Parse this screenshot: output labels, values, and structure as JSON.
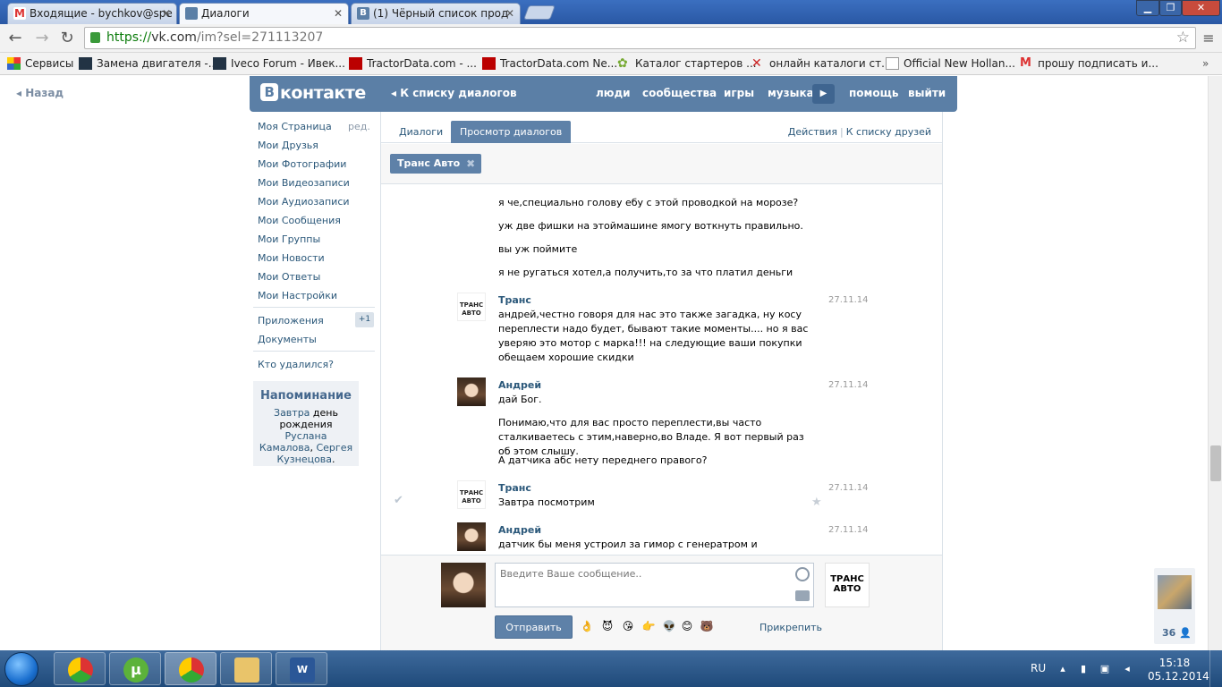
{
  "browser": {
    "tabs": [
      {
        "title": "Входящие - bychkov@spe",
        "icon": "gmail-icon"
      },
      {
        "title": "Диалоги",
        "icon": "vk-dialog-icon"
      },
      {
        "title": "(1) Чёрный список прод",
        "icon": "vk-icon"
      }
    ],
    "url_scheme": "https://",
    "url_host": "vk.com",
    "url_path": "/im?sel=271113207",
    "bookmarks": [
      {
        "label": "Сервисы",
        "icon": "apps-grid-icon"
      },
      {
        "label": "Замена двигателя -...",
        "icon": "iveco-icon"
      },
      {
        "label": "Iveco Forum - Ивек...",
        "icon": "iveco-icon"
      },
      {
        "label": "TractorData.com - ...",
        "icon": "td-icon"
      },
      {
        "label": "TractorData.com Ne...",
        "icon": "td-icon"
      },
      {
        "label": "Каталог стартеров ...",
        "icon": "gear-icon"
      },
      {
        "label": "онлайн каталоги ст...",
        "icon": "cross-icon"
      },
      {
        "label": "Official New Hollan...",
        "icon": "page-icon"
      },
      {
        "label": "прошу подписать и...",
        "icon": "gmail-icon"
      }
    ]
  },
  "vk": {
    "back_label": "Назад",
    "logo_text": "контакте",
    "logo_letter": "В",
    "header_back": "К списку диалогов",
    "nav": [
      "люди",
      "сообщества",
      "игры",
      "музыка",
      "помощь",
      "выйти"
    ],
    "menu": {
      "edit": "ред.",
      "items": [
        "Моя Страница",
        "Мои Друзья",
        "Мои Фотографии",
        "Мои Видеозаписи",
        "Мои Аудиозаписи",
        "Мои Сообщения",
        "Мои Группы",
        "Мои Новости",
        "Мои Ответы",
        "Мои Настройки"
      ],
      "apps": "Приложения",
      "apps_badge": "+1",
      "docs": "Документы",
      "who_deleted": "Кто удалился?"
    },
    "reminder": {
      "title": "Напоминание",
      "tomorrow": "Завтра",
      "text1": " день рождения ",
      "person1": "Руслана Камалова",
      "comma": ", ",
      "person2": "Сергея Кузнецова",
      "dot": "."
    },
    "tabs": [
      "Диалоги",
      "Просмотр диалогов"
    ],
    "actions": "Действия",
    "friends_list": "К списку друзей",
    "peer_chip": "Транс Авто",
    "messages": [
      {
        "author": "",
        "date": "",
        "lines": [
          "я че,специально голову ебу с этой проводкой на морозе?"
        ]
      },
      {
        "author": "",
        "date": "",
        "lines": [
          "уж две фишки на этоймашине ямогу воткнуть правильно."
        ]
      },
      {
        "author": "",
        "date": "",
        "lines": [
          "вы уж поймите"
        ]
      },
      {
        "author": "",
        "date": "",
        "lines": [
          "я не ругаться хотел,а получить,то за что платил деньги"
        ]
      },
      {
        "author": "Транс",
        "date": "27.11.14",
        "lines": [
          "андрей,честно говоря для нас это также загадка, ну косу переплести надо будет, бывают такие моменты.... но я вас уверяю это мотор с марка!!! на следующие ваши покупки обещаем хорошие скидки"
        ]
      },
      {
        "author": "Андрей",
        "date": "27.11.14",
        "lines": [
          "дай Бог.",
          "Понимаю,что для вас просто переплести,вы часто сталкиваетесь с этим,наверно,во Владе. Я вот первый раз об этом слышу.",
          "А датчика абс нету переднего правого?"
        ]
      },
      {
        "author": "Транс",
        "date": "27.11.14",
        "lines": [
          "Завтра посмотрим"
        ]
      },
      {
        "author": "Андрей",
        "date": "27.11.14",
        "lines": [
          "датчик бы меня устроил за гимор с генератром и проводкой"
        ]
      }
    ],
    "trans_avatar_text": "ТРАНС АВТО",
    "input_placeholder": "Введите Ваше сообщение..",
    "send_label": "Отправить",
    "attach_label": "Прикрепить",
    "emoji": [
      "👌",
      "😈",
      "😘",
      "👉",
      "👽",
      "😊",
      "🐻"
    ],
    "side_widget_count": "36"
  },
  "taskbar": {
    "lang": "RU",
    "time": "15:18",
    "date": "05.12.2014"
  },
  "colors": {
    "vk_blue": "#5b7fa6",
    "link": "#2b587a",
    "chrome_blue": "#2a58a4"
  }
}
